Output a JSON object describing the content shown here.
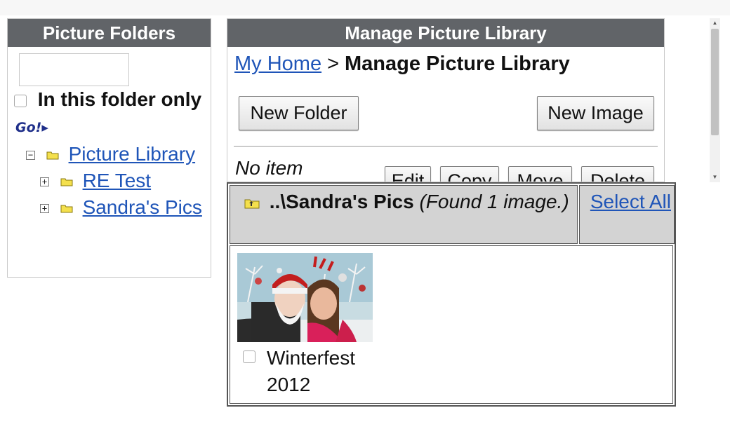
{
  "left_panel": {
    "title": "Picture Folders",
    "search_value": "",
    "filter_label": "In this folder only",
    "go_label": "Go!▸",
    "tree": [
      {
        "label": "Picture Library",
        "expander": "−",
        "icon": "folder-icon"
      },
      {
        "label": "RE Test",
        "expander": "+",
        "icon": "folder-icon"
      },
      {
        "label": "Sandra's Pics",
        "expander": "+",
        "icon": "folder-icon"
      }
    ]
  },
  "main": {
    "title": "Manage Picture Library",
    "breadcrumb": {
      "home": "My Home",
      "separator": ">",
      "current": "Manage Picture Library"
    },
    "new_folder_label": "New Folder",
    "new_image_label": "New Image",
    "no_item_text": "No item",
    "actions": [
      "Edit",
      "Copy",
      "Move",
      "Delete"
    ]
  },
  "folder_view": {
    "folder_name": "..\\Sandra's Pics",
    "found_text": "(Found 1 image.)",
    "select_all_label": "Select All",
    "images": [
      {
        "label": "Winterfest 2012",
        "icon": "photo-thumbnail"
      }
    ]
  },
  "colors": {
    "header_bg": "#616468",
    "link": "#1f55b8",
    "table_header_bg": "#d3d3d3"
  }
}
